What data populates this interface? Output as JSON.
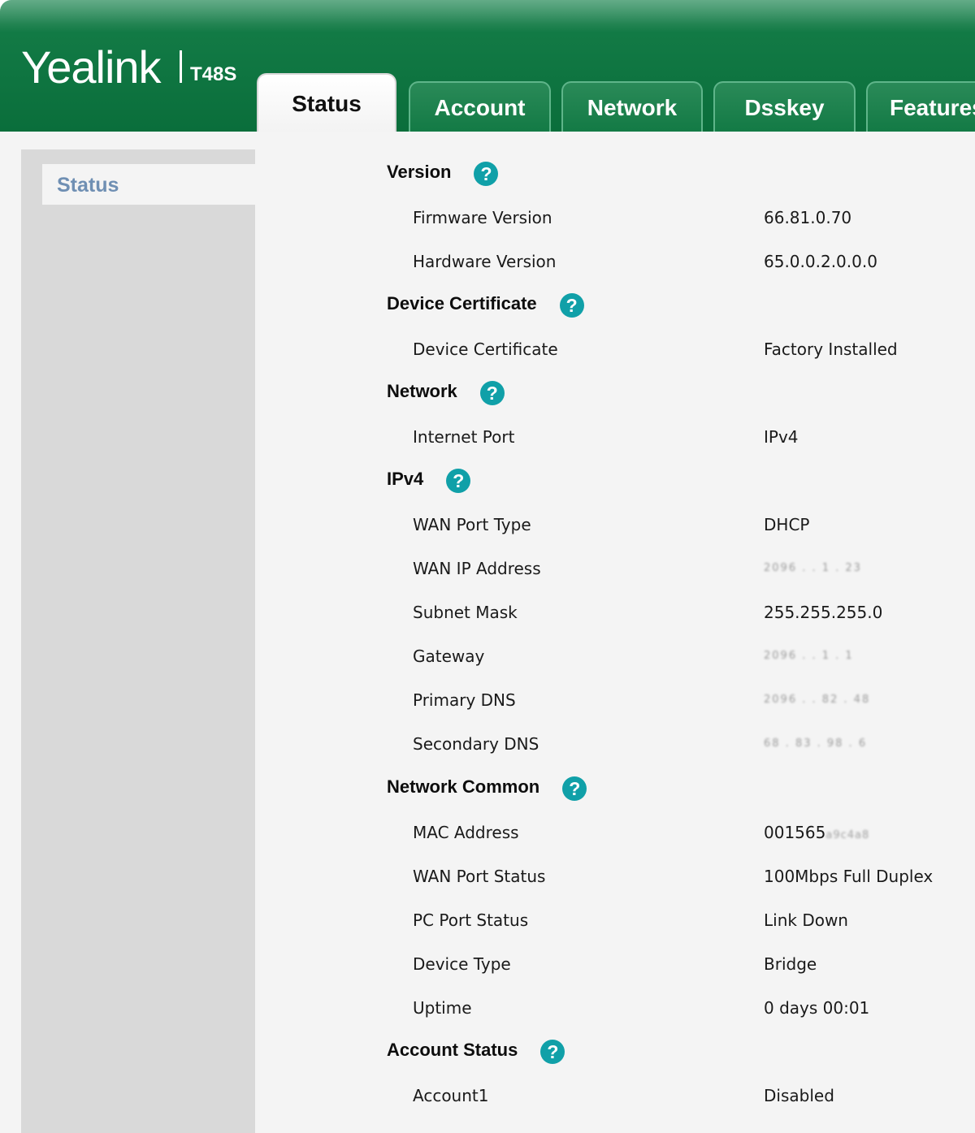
{
  "header": {
    "logo": "Yealink",
    "model": "T48S",
    "tabs": [
      {
        "label": "Status",
        "active": true
      },
      {
        "label": "Account",
        "active": false
      },
      {
        "label": "Network",
        "active": false
      },
      {
        "label": "Dsskey",
        "active": false
      },
      {
        "label": "Features",
        "active": false
      }
    ]
  },
  "sidebar": {
    "items": [
      {
        "label": "Status",
        "active": true
      }
    ]
  },
  "sections": {
    "version": {
      "title": "Version",
      "firmware_label": "Firmware Version",
      "firmware_value": "66.81.0.70",
      "hardware_label": "Hardware Version",
      "hardware_value": "65.0.0.2.0.0.0"
    },
    "certificate": {
      "title": "Device Certificate",
      "cert_label": "Device Certificate",
      "cert_value": "Factory Installed"
    },
    "network": {
      "title": "Network",
      "port_label": "Internet Port",
      "port_value": "IPv4"
    },
    "ipv4": {
      "title": "IPv4",
      "wan_type_label": "WAN Port Type",
      "wan_type_value": "DHCP",
      "wan_ip_label": "WAN IP Address",
      "wan_ip_value": "2096 . . 1 . 23",
      "subnet_label": "Subnet Mask",
      "subnet_value": "255.255.255.0",
      "gateway_label": "Gateway",
      "gateway_value": "2096 . . 1 . 1",
      "dns1_label": "Primary DNS",
      "dns1_value": "2096 . . 82 . 48",
      "dns2_label": "Secondary DNS",
      "dns2_value": "68 . 83 . 98 . 6"
    },
    "network_common": {
      "title": "Network Common",
      "mac_label": "MAC Address",
      "mac_value": "001565",
      "mac_suffix": "a9c4a8",
      "wan_status_label": "WAN Port Status",
      "wan_status_value": "100Mbps Full Duplex",
      "pc_status_label": "PC Port Status",
      "pc_status_value": "Link Down",
      "device_type_label": "Device Type",
      "device_type_value": "Bridge",
      "uptime_label": "Uptime",
      "uptime_value": "0 days 00:01"
    },
    "account_status": {
      "title": "Account Status",
      "account1_label": "Account1",
      "account1_value": "Disabled"
    }
  },
  "icons": {
    "help": "?"
  },
  "colors": {
    "header_green": "#0a6e3b",
    "help_teal": "#10a0a8",
    "sidebar_link": "#6f8fb3"
  }
}
